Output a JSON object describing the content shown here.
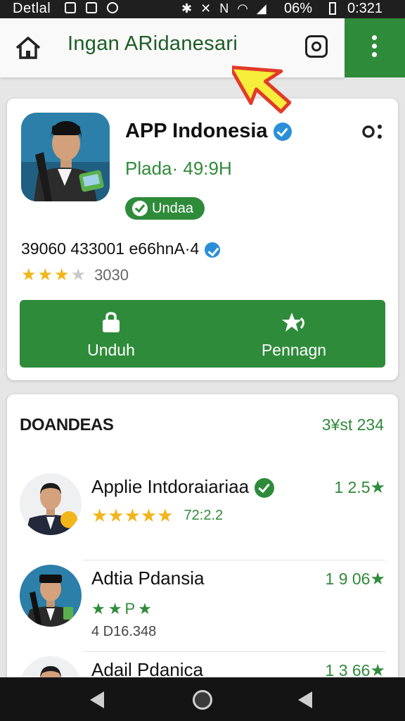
{
  "status_bar": {
    "carrier": "Detlal",
    "battery": "06%",
    "percent_sign": "%",
    "time": "0:321"
  },
  "app_bar": {
    "title": "Ingan ARidanesari",
    "home_icon": "home-icon",
    "instagram_icon": "camera-icon",
    "more_icon": "more-vert-icon",
    "accent": "#2e8b3a"
  },
  "app_card": {
    "name": "APP Indonesia",
    "subtitle": "Plada· 49:9H",
    "badge": "Undaa",
    "meta": "39060 433001 e66hnA·4",
    "rating": {
      "stars_filled": 3,
      "stars_total": 4,
      "count": "3030"
    },
    "actions": [
      {
        "label": "Unduh",
        "icon": "lock-icon"
      },
      {
        "label": "Pennagn",
        "icon": "star-sparkle-icon"
      }
    ]
  },
  "list": {
    "title": "DOANDEAS",
    "count": "3¥st 234",
    "items": [
      {
        "title": "Applie Intdoraiariaa",
        "verified": true,
        "score": "1 2.5",
        "stars": "★★★★★",
        "rating_text": "72:2.2"
      },
      {
        "title": "Adtia Pdansia",
        "score": "1 9 06",
        "green_stars": "★★Р★",
        "extra": "4 D16.348"
      },
      {
        "title": "Adail Pdanica",
        "score": "1 3 66"
      }
    ],
    "score_star": "★"
  },
  "colors": {
    "green": "#2e8b3a",
    "star_gold": "#f2b51a",
    "verified_blue": "#2a8fd8"
  }
}
